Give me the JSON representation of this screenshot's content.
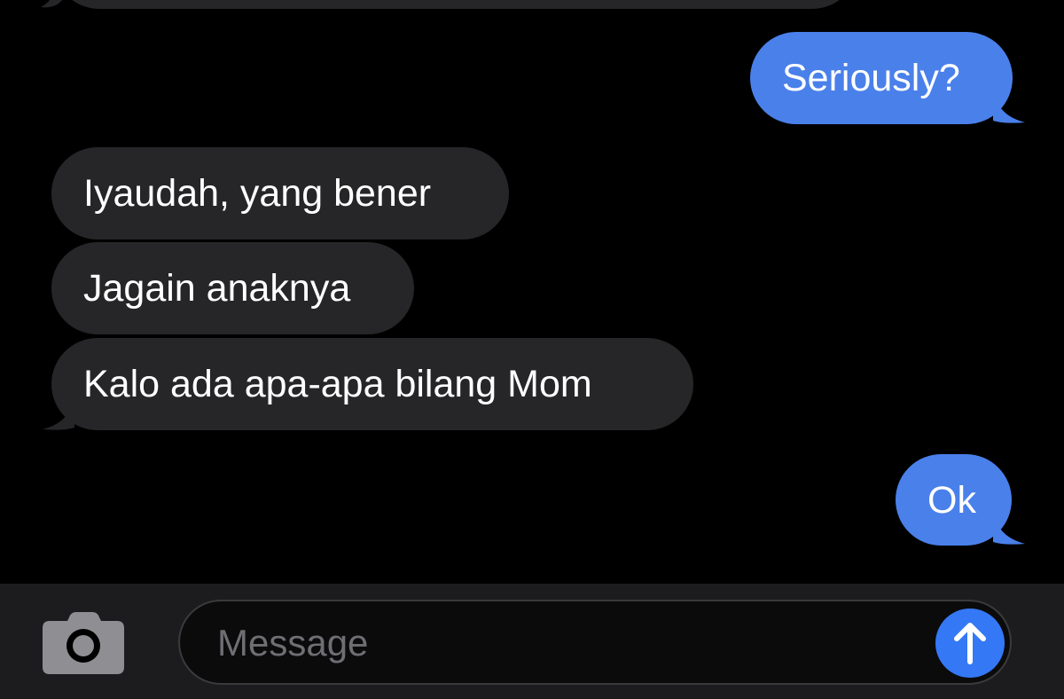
{
  "messages": [
    {
      "direction": "outgoing",
      "text": "Seriously?"
    },
    {
      "direction": "incoming",
      "text": "Iyaudah, yang bener"
    },
    {
      "direction": "incoming",
      "text": "Jagain anaknya"
    },
    {
      "direction": "incoming",
      "text": "Kalo ada apa-apa bilang Mom"
    },
    {
      "direction": "outgoing",
      "text": "Ok"
    }
  ],
  "composer": {
    "placeholder": "Message",
    "value": "",
    "camera_icon": "camera-icon",
    "send_icon": "arrow-up-icon"
  },
  "colors": {
    "background": "#000000",
    "incoming_bubble": "#262628",
    "outgoing_bubble": "#4a80ea",
    "send_button": "#3478f6",
    "composer_bar": "#1c1c1e"
  }
}
